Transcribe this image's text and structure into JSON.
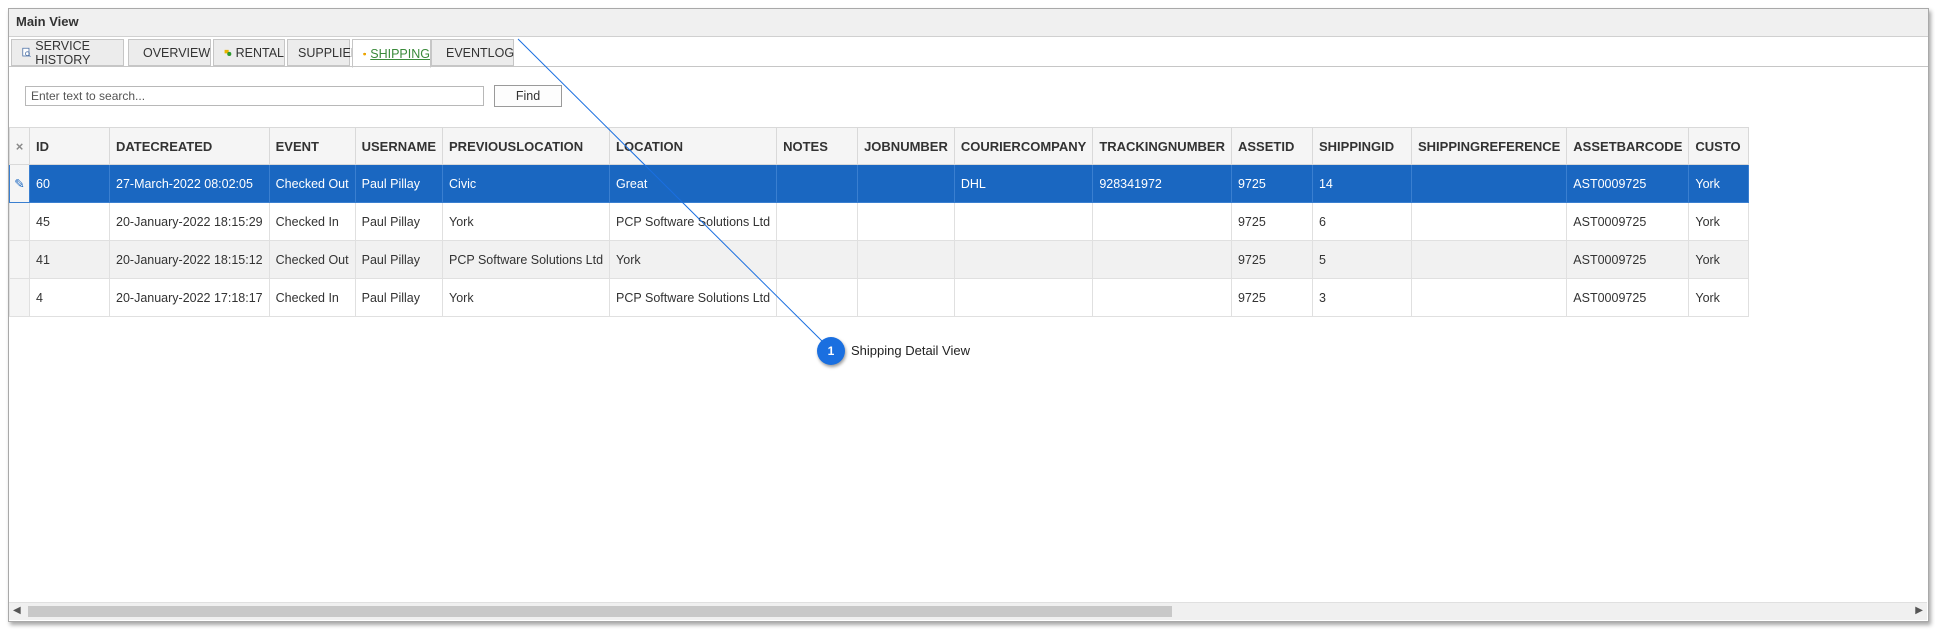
{
  "window": {
    "title": "Main View"
  },
  "tabs": [
    {
      "label": "SERVICE HISTORY",
      "icon": "document-search-icon"
    },
    {
      "label": "OVERVIEW",
      "icon": "list-icon"
    },
    {
      "label": "RENTAL",
      "icon": "rental-icon"
    },
    {
      "label": "SUPPLIER",
      "icon": ""
    },
    {
      "label": "SHIPPING",
      "icon": "box-icon",
      "active": true
    },
    {
      "label": "EVENTLOG",
      "icon": "log-icon"
    }
  ],
  "search": {
    "placeholder": "Enter text to search...",
    "find_label": "Find"
  },
  "table": {
    "indicator_header": "×",
    "columns": [
      "ID",
      "DATECREATED",
      "EVENT",
      "USERNAME",
      "PREVIOUSLOCATION",
      "LOCATION",
      "NOTES",
      "JOBNUMBER",
      "COURIERCOMPANY",
      "TRACKINGNUMBER",
      "ASSETID",
      "SHIPPINGID",
      "SHIPPINGREFERENCE",
      "ASSETBARCODE",
      "CUSTO"
    ],
    "rows": [
      {
        "indicator": "✎",
        "cells": [
          "60",
          "27-March-2022 08:02:05",
          "Checked Out",
          "Paul Pillay",
          "Civic",
          "Great",
          "",
          "",
          "DHL",
          "928341972",
          "9725",
          "14",
          "",
          "AST0009725",
          "York"
        ]
      },
      {
        "indicator": "",
        "cells": [
          "45",
          "20-January-2022 18:15:29",
          "Checked In",
          "Paul Pillay",
          "York",
          "PCP Software Solutions Ltd",
          "",
          "",
          "",
          "",
          "9725",
          "6",
          "",
          "AST0009725",
          "York"
        ]
      },
      {
        "indicator": "",
        "cells": [
          "41",
          "20-January-2022 18:15:12",
          "Checked Out",
          "Paul Pillay",
          "PCP Software Solutions Ltd",
          "York",
          "",
          "",
          "",
          "",
          "9725",
          "5",
          "",
          "AST0009725",
          "York"
        ]
      },
      {
        "indicator": "",
        "cells": [
          "4",
          "20-January-2022 17:18:17",
          "Checked In",
          "Paul Pillay",
          "York",
          "PCP Software Solutions Ltd",
          "",
          "",
          "",
          "",
          "9725",
          "3",
          "",
          "AST0009725",
          "York"
        ]
      }
    ]
  },
  "callout": {
    "number": "1",
    "text": "Shipping Detail View"
  },
  "colors": {
    "selection": "#1a67c1",
    "callout": "#1a6fe0",
    "active_tab_text": "#3a8a3a"
  }
}
